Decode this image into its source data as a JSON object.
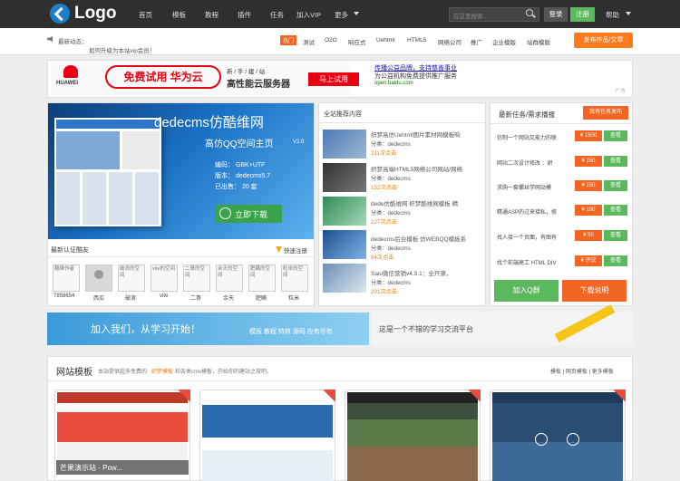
{
  "header": {
    "logo": "Logo",
    "nav": [
      "首页",
      "模板",
      "教程",
      "插件",
      "任务",
      "加入VIP",
      "更多"
    ],
    "search_placeholder": "在这里搜索...",
    "login": "登录",
    "register": "注册",
    "help": "帮助"
  },
  "notice": {
    "label": "最新动态：",
    "text": "如何升级为本站vip会员！",
    "hot": "热门",
    "tags": [
      "测试",
      "O2O",
      "响应式",
      "Uehtml",
      "HTML5",
      "网络公司",
      "推广",
      "企业模版",
      "站群模版"
    ],
    "publish": "发布作品/文章"
  },
  "ad": {
    "huawei": "HUAWEI",
    "headline": "免费试用 华为云",
    "slogan": "新 / 手 / 建 / 站",
    "product": "高性能云服务器",
    "cta": "马上试用",
    "text_title": "传播公益品牌，支持慈善事业",
    "text_body": "为公益机构免费提供推广服务",
    "text_url": "open.baidu.com",
    "label": "广告"
  },
  "banner": {
    "title": "dedecms仿酷维网",
    "subtitle": "高仿QQ空间主页",
    "version_tag": "V2.0",
    "encoding": "编码：  GBK+UTF",
    "version": "版本：  dedecms5.7",
    "sold": "已出售：  20  套",
    "download": "立即下载"
  },
  "certified": {
    "title": "最新认证酷友",
    "register": "快速注册",
    "users": [
      {
        "alt": "酷维作者",
        "name": "7858654"
      },
      {
        "alt": "",
        "name": "西瓜"
      },
      {
        "alt": "破浪的空间",
        "name": "破浪"
      },
      {
        "alt": "vite的空间",
        "name": "vite"
      },
      {
        "alt": "二哥的空间",
        "name": "二哥"
      },
      {
        "alt": "余天的空间",
        "name": "余天"
      },
      {
        "alt": "肥瞒的空间",
        "name": "肥瞒"
      },
      {
        "alt": "粒米的空间",
        "name": "粒米"
      }
    ]
  },
  "recommend": {
    "title": "全站推荐内容",
    "items": [
      {
        "title": "织梦高仿Uehtml图片素材网模板响",
        "cat": "分类：dedecms",
        "stat": "211次点击"
      },
      {
        "title": "织梦高端HTML5网络公司网站/网络",
        "cat": "分类：dedecms",
        "stat": "152次点击"
      },
      {
        "title": "dede仿酷维网 织梦酷维网模板 精",
        "cat": "分类：dedecms",
        "stat": "227次点击"
      },
      {
        "title": "dedecms后台模板 仿WEBQQ模板系",
        "cat": "分类：dedecms",
        "stat": "84次点击"
      },
      {
        "title": "Saiu微信营销v4.3.1：全开源，",
        "cat": "分类：dedecms",
        "stat": "201次点击"
      }
    ]
  },
  "tasks": {
    "title": "最新任务/需求播报",
    "button": "我有任务发布",
    "items": [
      {
        "text": "仿制一个网站又能力的联",
        "price": "¥ 1500",
        "view": "查看"
      },
      {
        "text": "网站二次设计修改 ：织",
        "price": "¥ 150",
        "view": "查看"
      },
      {
        "text": "求购一套螺丝学网站模",
        "price": "¥ 150",
        "view": "查看"
      },
      {
        "text": "精通ASP的过来接私，修",
        "price": "¥ 100",
        "view": "查看"
      },
      {
        "text": "找人接一个页面，有图有",
        "price": "¥ 50",
        "view": "查看"
      },
      {
        "text": "找个前端高工 HTML DIV",
        "price": "¥ 评议",
        "view": "查看"
      }
    ],
    "join_qq": "加入Q群",
    "download": "下载说明"
  },
  "promo": {
    "left_main": "加入我们，从学习开始！",
    "left_sub": "模板  教程  特效  源码  应有尽有",
    "right": "这是一个不错的学习交流平台"
  },
  "templates": {
    "title": "网站模板",
    "desc_pre": "本站提供超多免费的",
    "desc_hl": "织梦模板",
    "desc_post": "和各类cms模板，开始你的建站之旅吧。",
    "crumb": "模板 | 网页模板 | 更多模板",
    "card1": "芒果演示站 - Pow..."
  },
  "colors": {
    "accent": "#f26522",
    "green": "#5cb85c",
    "blue": "#1c7ec9"
  }
}
